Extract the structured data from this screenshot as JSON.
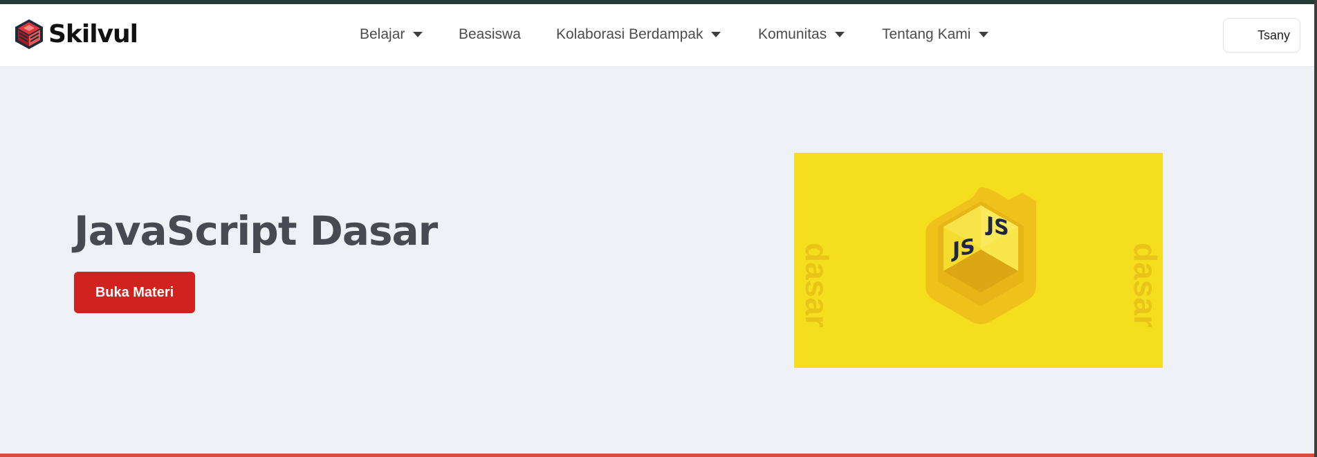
{
  "brand": {
    "name": "Skilvul",
    "logo_icon": "skilvul-logo-icon",
    "accent_color": "#d1221f"
  },
  "nav": {
    "items": [
      {
        "label": "Belajar",
        "has_dropdown": true
      },
      {
        "label": "Beasiswa",
        "has_dropdown": false
      },
      {
        "label": "Kolaborasi Berdampak",
        "has_dropdown": true
      },
      {
        "label": "Komunitas",
        "has_dropdown": true
      },
      {
        "label": "Tentang Kami",
        "has_dropdown": true
      }
    ],
    "dropdown_icon": "caret-down-icon"
  },
  "user": {
    "name": "Tsany"
  },
  "hero": {
    "title": "JavaScript Dasar",
    "cta_label": "Buka Materi"
  },
  "course_image": {
    "background_color": "#f5de1d",
    "side_text": "dasar",
    "cube_face_label": "JS"
  }
}
